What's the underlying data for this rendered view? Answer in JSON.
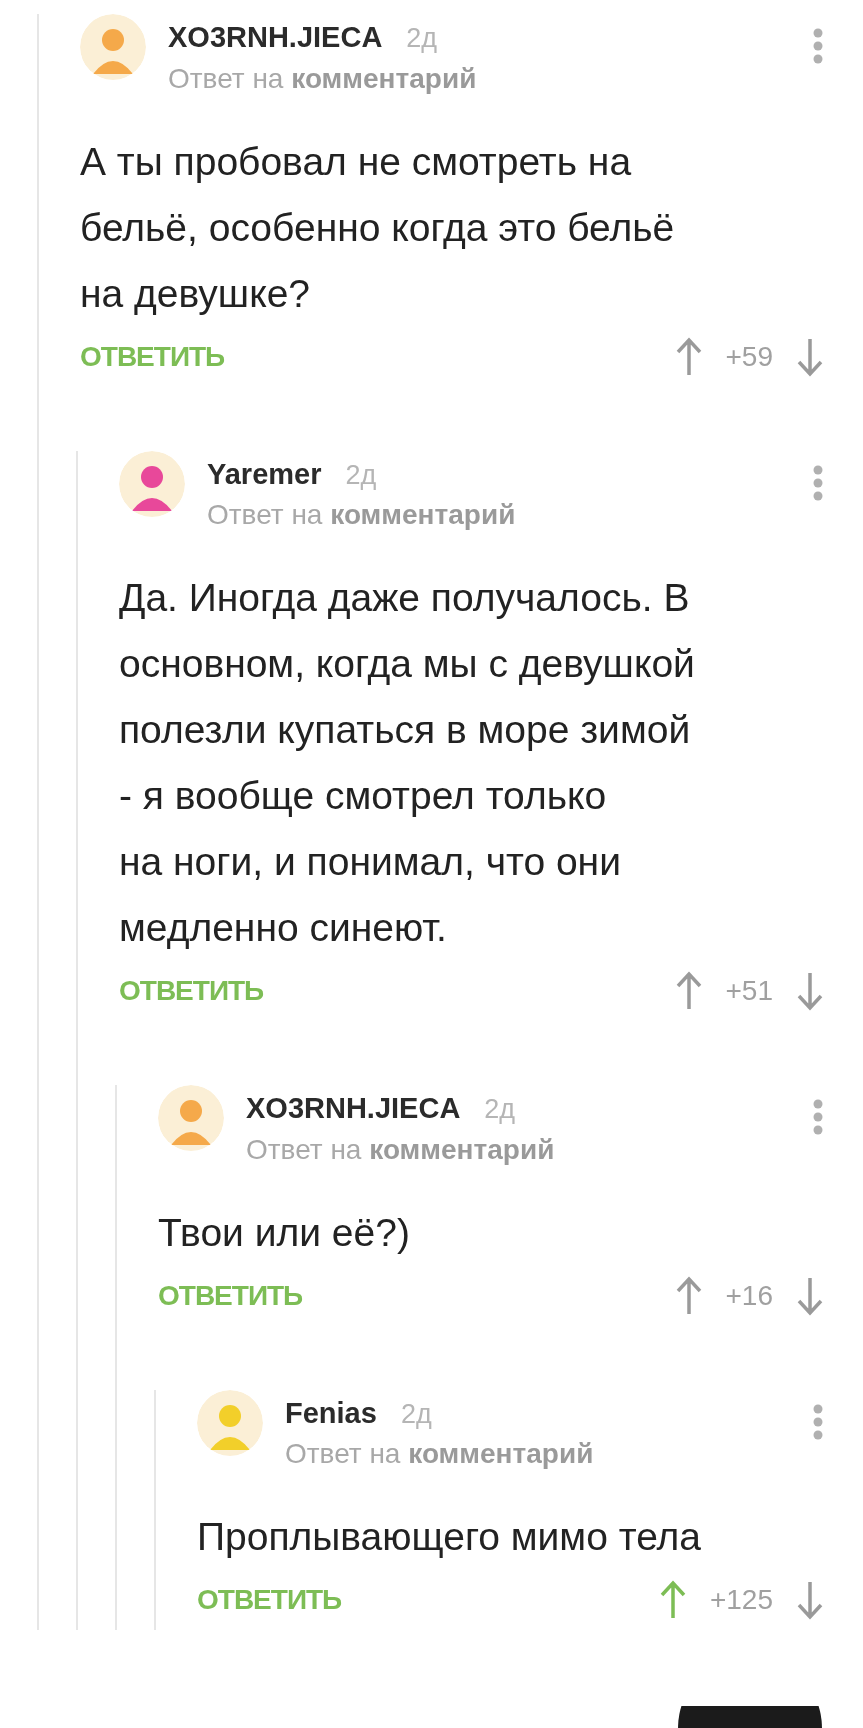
{
  "comments": [
    {
      "author": "XO3RNH.JIECA",
      "time": "2д",
      "reply_to": "Ответ на **комментарий**",
      "text": "А ты пробовал не смотреть на\nбельё, особенно когда это бельё\nна девушке?",
      "reply_label": "ОТВЕТИТЬ",
      "score": "+59",
      "upvoted": false,
      "children": [
        {
          "author": "Yaremer",
          "time": "2д",
          "reply_to": "Ответ на **комментарий**",
          "text": "Да. Иногда даже получалось. В\nосновном, когда мы с девушкой\nполезли купаться в море зимой\n- я вообще смотрел только\nна ноги, и понимал, что они\nмедленно синеют.",
          "reply_label": "ОТВЕТИТЬ",
          "score": "+51",
          "upvoted": false,
          "children": [
            {
              "author": "XO3RNH.JIECA",
              "time": "2д",
              "reply_to": "Ответ на **комментарий**",
              "text": "Твои или её?)",
              "reply_label": "ОТВЕТИТЬ",
              "score": "+16",
              "upvoted": false,
              "children": [
                {
                  "author": "Fenias",
                  "time": "2д",
                  "reply_to": "Ответ на **комментарий**",
                  "text": "Проплывающего мимо тела",
                  "reply_label": "ОТВЕТИТЬ",
                  "score": "+125",
                  "upvoted": true
                }
              ]
            }
          ]
        }
      ]
    }
  ]
}
